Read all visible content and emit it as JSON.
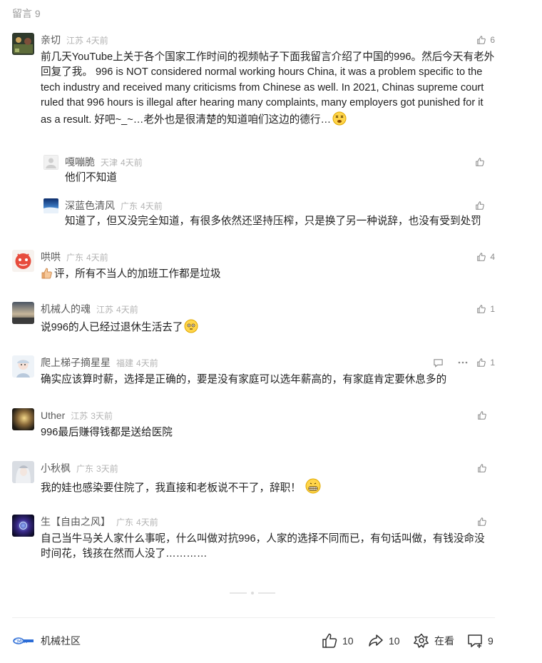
{
  "section_title": "留言 9",
  "comments": [
    {
      "name": "亲切",
      "location": "江苏",
      "time": "4天前",
      "likes": "6",
      "text": "前几天YouTube上关于各个国家工作时间的视频帖子下面我留言介绍了中国的996。然后今天有老外回复了我。 996 is NOT considered normal working hours China, it was a problem specific to the tech industry and received many criticisms from Chinese as well. In 2021, Chinas supreme court ruled that 996 hours is illegal after hearing many complaints, many employers got punished for it as a result. 好吧~_~…老外也是很清楚的知道咱们这边的德行…"
    },
    {
      "name": "嘎嘣脆",
      "location": "天津",
      "time": "4天前",
      "likes": "",
      "text": "他们不知道"
    },
    {
      "name": "深蓝色清风",
      "location": "广东",
      "time": "4天前",
      "likes": "",
      "text": "知道了，但又没完全知道，有很多依然还坚持压榨，只是换了另一种说辞，也没有受到处罚"
    },
    {
      "name": "哄哄",
      "location": "广东",
      "time": "4天前",
      "likes": "4",
      "text": "评，所有不当人的加班工作都是垃圾"
    },
    {
      "name": "机械人的魂",
      "location": "江苏",
      "time": "4天前",
      "likes": "1",
      "text": "说996的人已经过退休生活去了"
    },
    {
      "name": "爬上梯子摘星星",
      "location": "福建",
      "time": "4天前",
      "likes": "1",
      "text": "确实应该算时薪，选择是正确的，要是没有家庭可以选年薪高的，有家庭肯定要休息多的"
    },
    {
      "name": "Uther",
      "location": "江苏",
      "time": "3天前",
      "likes": "",
      "text": "996最后赚得钱都是送给医院"
    },
    {
      "name": "小秋枫",
      "location": "广东",
      "time": "3天前",
      "likes": "",
      "text": "我的娃也感染要住院了，我直接和老板说不干了，辞职！"
    },
    {
      "name": "生【自由之风】",
      "location": "广东",
      "time": "4天前",
      "likes": "",
      "text": "自己当牛马关人家什么事呢，什么叫做对抗996，人家的选择不同而已，有句话叫做，有钱没命没时间花，钱孩在然而人没了…………"
    }
  ],
  "footer": {
    "brand_name": "机械社区",
    "like_count": "10",
    "share_count": "10",
    "watch_label": "在看",
    "comment_count": "9"
  },
  "icons": {
    "like": "thumbs-up-icon",
    "reply": "chat-bubble-icon",
    "more": "ellipsis-icon",
    "share": "share-arrow-icon",
    "watch": "watching-icon",
    "comment": "comment-plus-icon"
  }
}
